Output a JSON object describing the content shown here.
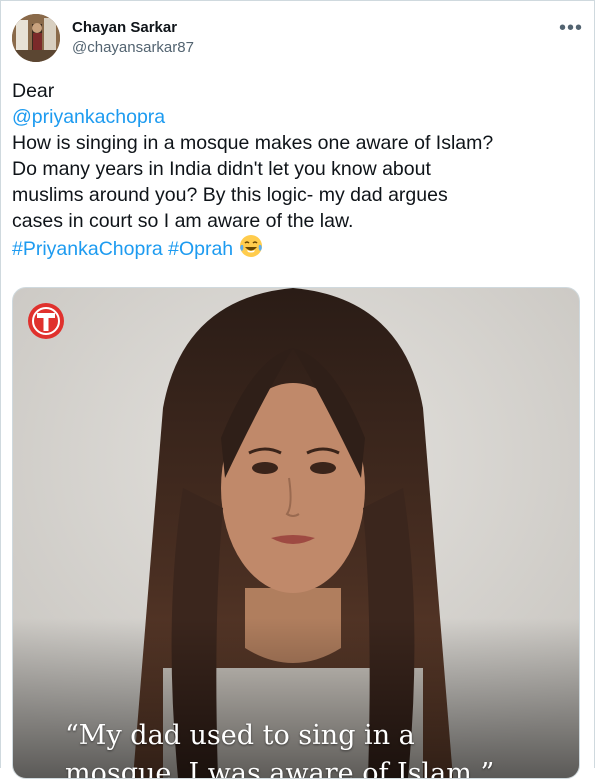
{
  "author": {
    "display_name": "Chayan Sarkar",
    "handle": "@chayansarkar87",
    "avatar_icon": "profile-photo"
  },
  "menu": {
    "icon": "more-horizontal-icon",
    "label": "•••"
  },
  "tweet": {
    "salutation": "Dear",
    "mention": "@priyankachopra",
    "lines": [
      "How is singing in a mosque makes one aware of Islam?",
      "Do many years in India didn't let you know about",
      "muslims around you? By this logic- my dad argues",
      "cases in court so I am aware of the law."
    ],
    "hashtags": [
      "#PriyankaChopra",
      "#Oprah"
    ],
    "emoji": "laughing-with-tears-emoji"
  },
  "media": {
    "logo_icon": "t-channel-logo",
    "quote_line1": "“My dad used to sing in a",
    "quote_line2": "mosque. I was aware of Islam.”"
  },
  "colors": {
    "link": "#1d9bf0",
    "text": "#0f1419",
    "muted": "#536471",
    "border": "#cfd9de",
    "logo_red": "#e0312d"
  }
}
